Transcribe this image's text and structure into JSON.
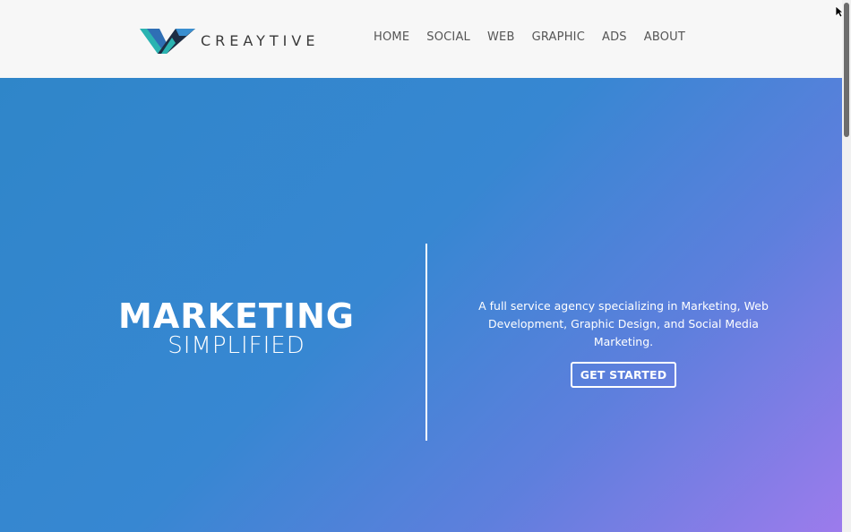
{
  "header": {
    "brand": "CREAYTIVE",
    "nav": [
      "HOME",
      "SOCIAL",
      "WEB",
      "GRAPHIC",
      "ADS",
      "ABOUT"
    ]
  },
  "hero": {
    "title": "MARKETING",
    "subtitle": "SIMPLIFIED",
    "description": "A full service agency specializing in Marketing, Web Development, Graphic Design, and Social Media Marketing.",
    "cta_label": "GET STARTED"
  },
  "colors": {
    "hero_gradient_start": "#2f86c9",
    "hero_gradient_end": "#9c7bec",
    "logo_teal": "#2bb3b1",
    "logo_blue": "#2f6fb5",
    "logo_dark": "#1d2d44"
  },
  "icons": {
    "logo_mark": "creaytive-logo-icon",
    "cursor": "mouse-pointer-icon"
  }
}
